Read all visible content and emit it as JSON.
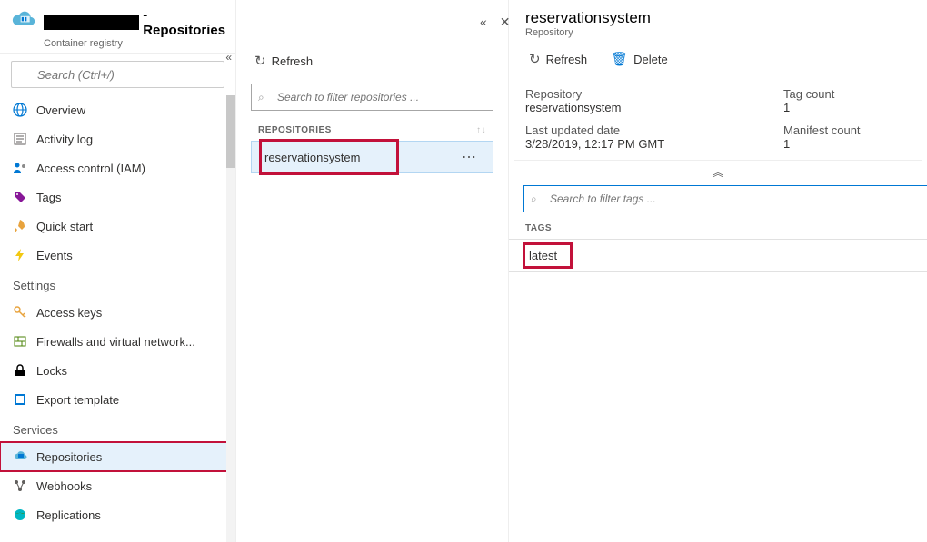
{
  "header": {
    "title_suffix": "- Repositories",
    "subtitle": "Container registry"
  },
  "sidebar": {
    "search_placeholder": "Search (Ctrl+/)",
    "items": [
      {
        "icon": "globe",
        "label": "Overview",
        "color": "c-blue"
      },
      {
        "icon": "log",
        "label": "Activity log",
        "color": "c-gray"
      },
      {
        "icon": "iam",
        "label": "Access control (IAM)",
        "color": "c-blue"
      },
      {
        "icon": "tag",
        "label": "Tags",
        "color": "c-purple"
      },
      {
        "icon": "rocket",
        "label": "Quick start",
        "color": "c-orange"
      },
      {
        "icon": "bolt",
        "label": "Events",
        "color": "c-yellow"
      }
    ],
    "settings_label": "Settings",
    "settings_items": [
      {
        "icon": "key",
        "label": "Access keys",
        "color": "c-orange"
      },
      {
        "icon": "firewall",
        "label": "Firewalls and virtual network...",
        "color": "c-green"
      },
      {
        "icon": "lock",
        "label": "Locks",
        "color": "c-black"
      },
      {
        "icon": "export",
        "label": "Export template",
        "color": "c-blue"
      }
    ],
    "services_label": "Services",
    "services_items": [
      {
        "icon": "repo",
        "label": "Repositories",
        "color": "c-blue",
        "selected": true
      },
      {
        "icon": "hook",
        "label": "Webhooks",
        "color": "c-gray"
      },
      {
        "icon": "globe2",
        "label": "Replications",
        "color": "c-teal"
      }
    ]
  },
  "middle": {
    "refresh_label": "Refresh",
    "filter_placeholder": "Search to filter repositories ...",
    "column_header": "REPOSITORIES",
    "repo_name": "reservationsystem"
  },
  "right": {
    "title": "reservationsystem",
    "subtitle": "Repository",
    "refresh_label": "Refresh",
    "delete_label": "Delete",
    "props": {
      "repository_label": "Repository",
      "repository_value": "reservationsystem",
      "tagcount_label": "Tag count",
      "tagcount_value": "1",
      "updated_label": "Last updated date",
      "updated_value": "3/28/2019, 12:17 PM GMT",
      "manifest_label": "Manifest count",
      "manifest_value": "1"
    },
    "tags_filter_placeholder": "Search to filter tags ...",
    "tags_header": "TAGS",
    "tag_value": "latest"
  }
}
